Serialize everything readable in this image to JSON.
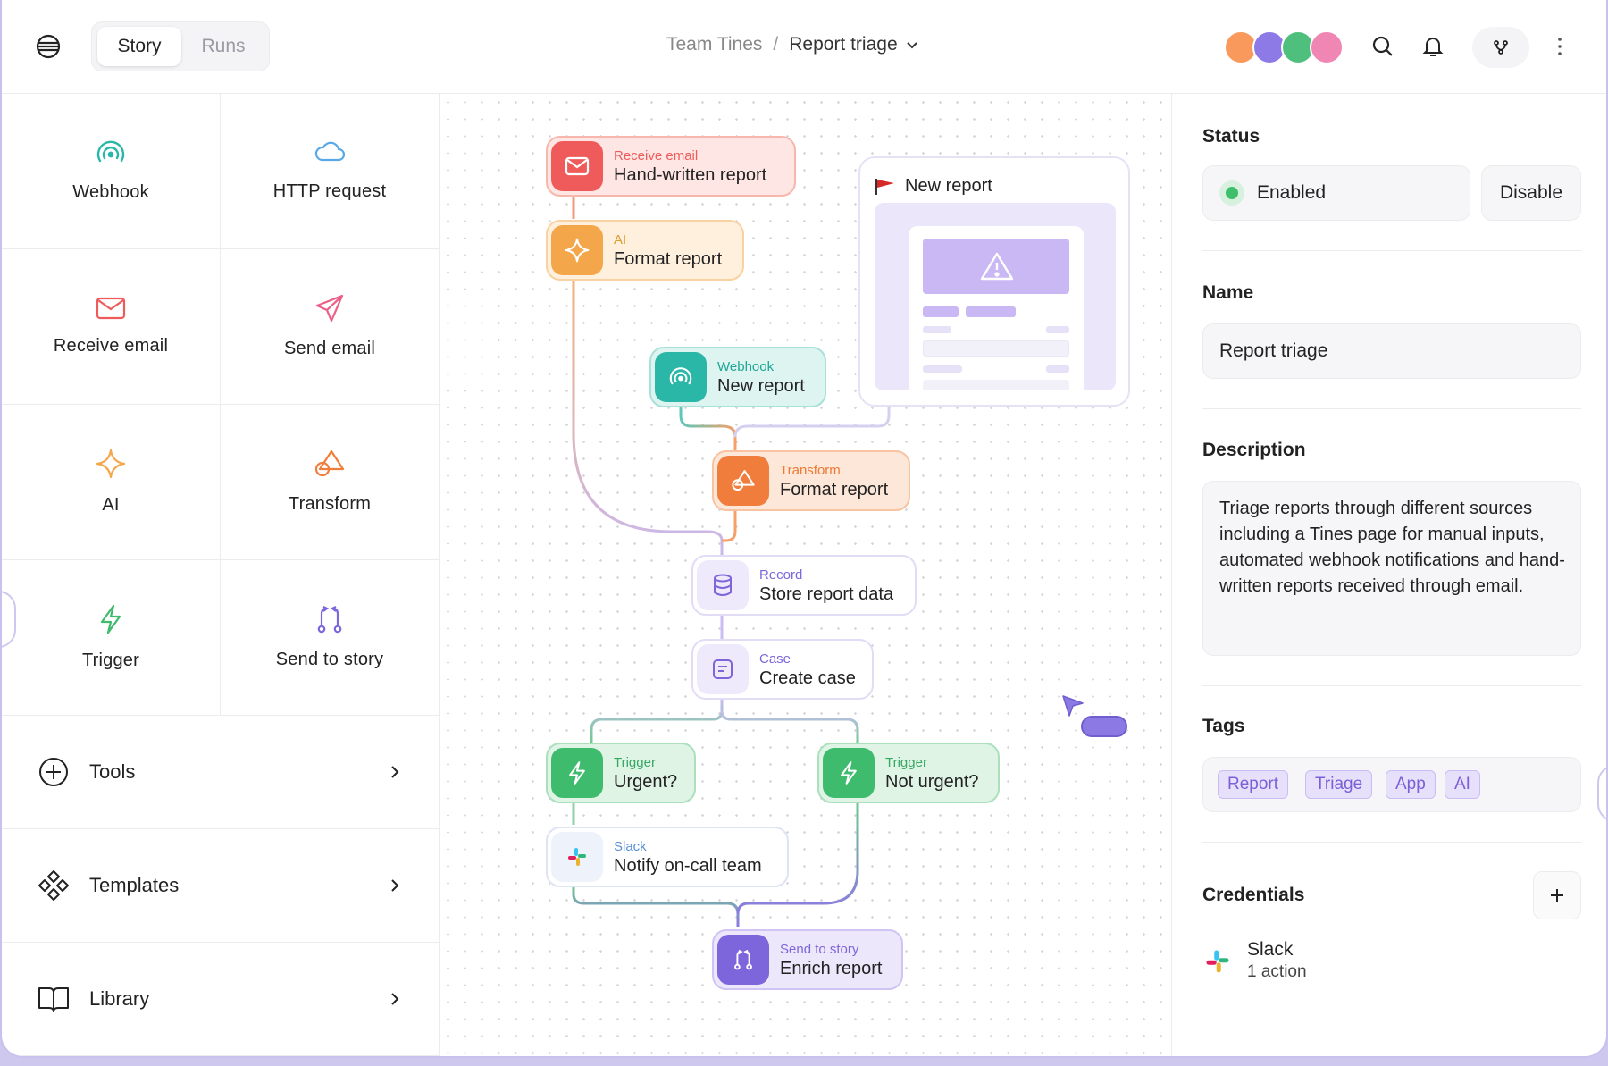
{
  "header": {
    "tabs": [
      {
        "label": "Story",
        "active": true
      },
      {
        "label": "Runs",
        "active": false
      }
    ],
    "breadcrumb": {
      "team": "Team Tines",
      "separator": "/",
      "story": "Report triage"
    },
    "avatar_colors": [
      "#f99a5c",
      "#8e7ae6",
      "#4fbf7d",
      "#ef86b3"
    ]
  },
  "palette": {
    "tiles": [
      {
        "label": "Webhook",
        "icon": "webhook-icon",
        "color": "#2bb7a7"
      },
      {
        "label": "HTTP request",
        "icon": "cloud-icon",
        "color": "#5aa9e6"
      },
      {
        "label": "Receive email",
        "icon": "mail-icon",
        "color": "#ef5b5b"
      },
      {
        "label": "Send email",
        "icon": "send-icon",
        "color": "#ec5f86"
      },
      {
        "label": "AI",
        "icon": "sparkle-icon",
        "color": "#f4a64a"
      },
      {
        "label": "Transform",
        "icon": "shapes-icon",
        "color": "#f07d3c"
      },
      {
        "label": "Trigger",
        "icon": "bolt-icon",
        "color": "#3fbb6d"
      },
      {
        "label": "Send to story",
        "icon": "story-icon",
        "color": "#7d66db"
      }
    ],
    "nav": [
      {
        "label": "Tools",
        "icon": "plus-circle-icon"
      },
      {
        "label": "Templates",
        "icon": "templates-icon"
      },
      {
        "label": "Library",
        "icon": "book-icon"
      }
    ]
  },
  "canvas": {
    "nodes": [
      {
        "type": "Receive email",
        "title": "Hand-written report",
        "color": "#ef5b5b"
      },
      {
        "type": "AI",
        "title": "Format report",
        "color": "#f4a64a"
      },
      {
        "type": "Webhook",
        "title": "New report",
        "color": "#2bb7a7"
      },
      {
        "type": "Transform",
        "title": "Format report",
        "color": "#f07d3c"
      },
      {
        "type": "Record",
        "title": "Store report data",
        "color": "#7d66db"
      },
      {
        "type": "Case",
        "title": "Create case",
        "color": "#7d66db"
      },
      {
        "type": "Trigger",
        "title": "Urgent?",
        "color": "#3fbb6d"
      },
      {
        "type": "Trigger",
        "title": "Not urgent?",
        "color": "#3fbb6d"
      },
      {
        "type": "Slack",
        "title": "Notify on-call team",
        "color": "#5aa9e6"
      },
      {
        "type": "Send to story",
        "title": "Enrich report",
        "color": "#7d66db"
      }
    ],
    "page_preview": {
      "title": "New report"
    }
  },
  "panel": {
    "status": {
      "title": "Status",
      "value": "Enabled",
      "button": "Disable"
    },
    "name": {
      "title": "Name",
      "value": "Report triage"
    },
    "description": {
      "title": "Description",
      "value": "Triage reports through different sources including a Tines page for manual inputs, automated webhook notifications and hand-written reports received through email."
    },
    "tags": {
      "title": "Tags",
      "items": [
        "Report",
        "Triage",
        "App",
        "AI"
      ]
    },
    "credentials": {
      "title": "Credentials",
      "items": [
        {
          "name": "Slack",
          "detail": "1 action"
        }
      ]
    }
  }
}
